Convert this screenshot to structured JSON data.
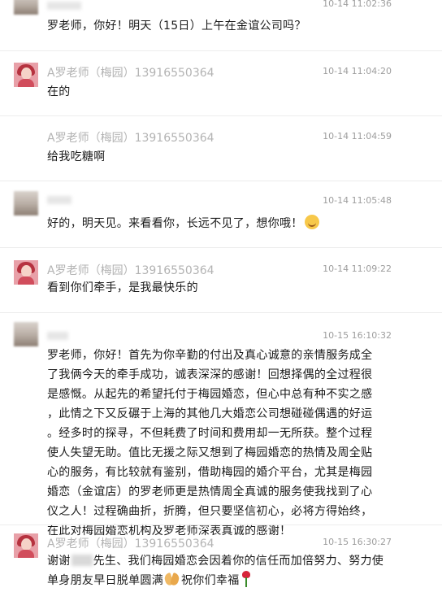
{
  "messages": [
    {
      "time": "10-14 11:02:36",
      "text": "罗老师，你好！明天（15日）上午在金谊公司吗？"
    },
    {
      "name": "A罗老师（梅园）13916550364",
      "time": "10-14 11:04:20",
      "text": "在的"
    },
    {
      "name": "A罗老师（梅园）13916550364",
      "time": "10-14 11:04:59",
      "text": "给我吃糖啊"
    },
    {
      "time": "10-14 11:05:48",
      "text": "好的，明天见。来看看你，长远不见了，想你哦！",
      "emoji": "smiling-face-emoji"
    },
    {
      "name": "A罗老师（梅园）13916550364",
      "time": "10-14 11:09:22",
      "text": "看到你们牵手，是我最快乐的"
    },
    {
      "time": "10-15 16:10:32",
      "lines": [
        "罗老师，你好！首先为你辛勤的付出及真心诚意的亲情服务成全",
        "了我俩今天的牵手成功，诚表深深的感谢！回想择偶的全过程很",
        "是感慨。从起先的希望托付于梅园婚恋，但心中总有种不实之感",
        "，此情之下又反碾于上海的其他几大婚恋公司想碰碰偶遇的好运",
        "。经多时的探寻，不但耗费了时间和费用却一无所获。整个过程",
        "使人失望无助。值比无援之际又想到了梅园婚恋的热情及周全贴",
        "心的服务，有比较就有鉴别，借助梅园的婚介平台，尤其是梅园",
        "婚恋（金谊店）的罗老师更是热情周全真诚的服务使我找到了心",
        "仪之人！过程确曲折，折腾，但只要坚信初心，必将方得始终，",
        "在此对梅园婚恋机构及罗老师深表真诚的感谢！"
      ]
    },
    {
      "name": "A罗老师（梅园）13916550364",
      "time": "10-15 16:30:27",
      "line1_a": "谢谢",
      "line1_b": "先生、我们梅园婚恋会因着你的信任而加倍努力、努力使",
      "line2_a": "单身朋友早日脱单圆满",
      "line2_b": "祝你们幸福",
      "emoji1": "praying-hands-emoji",
      "emoji2": "rose-emoji"
    }
  ],
  "colors": {
    "name_gray": "#b3b3b3",
    "time_gray": "#9d9d9d",
    "separator": "#ececec",
    "avatar_pink": "#e8a0a8"
  }
}
